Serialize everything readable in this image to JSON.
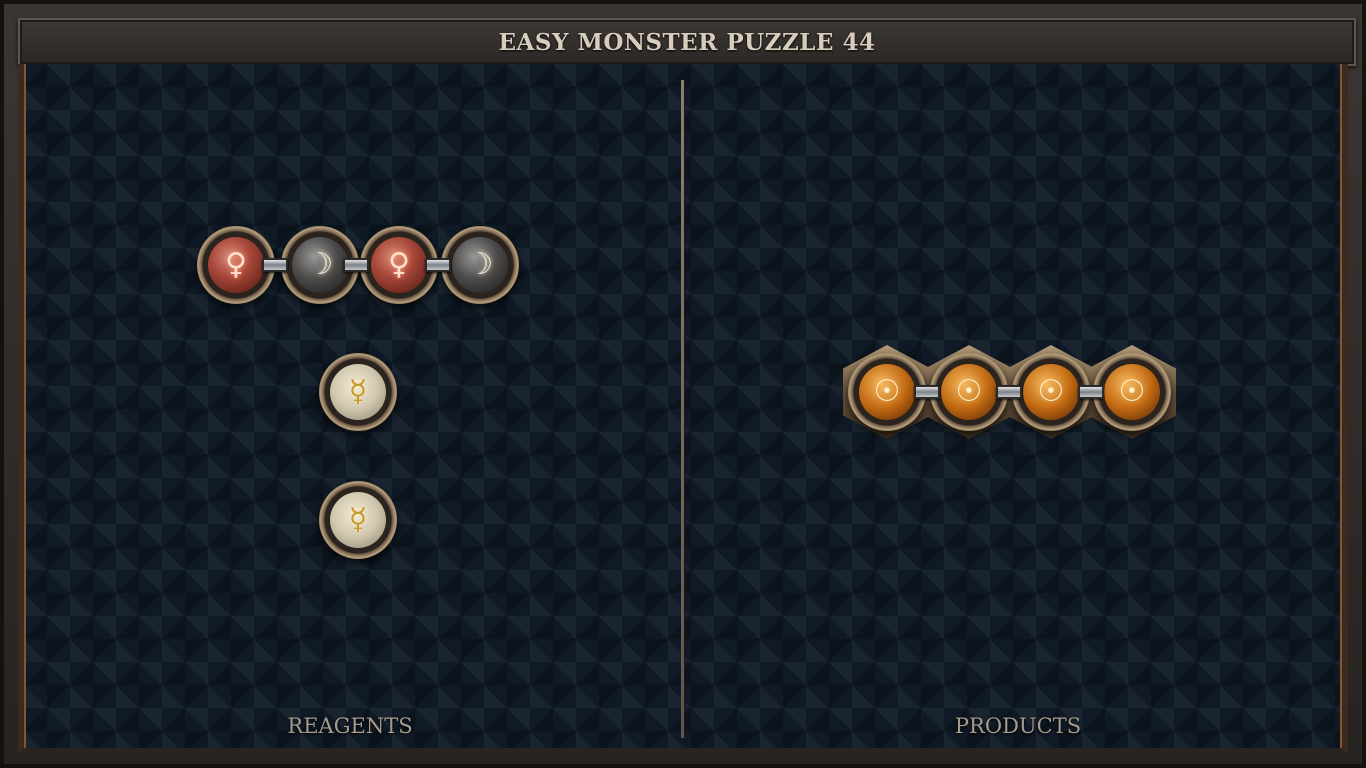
{
  "title": "EASY MONSTER PUZZLE 44",
  "sections": {
    "reagents_label": "REAGENTS",
    "products_label": "PRODUCTS"
  },
  "reagents": {
    "molecule_1": [
      {
        "element": "copper",
        "symbol": "♀"
      },
      {
        "element": "silver",
        "symbol": "☽"
      },
      {
        "element": "copper",
        "symbol": "♀"
      },
      {
        "element": "silver",
        "symbol": "☽"
      }
    ],
    "molecule_2": [
      {
        "element": "quicksilver",
        "symbol": "☿"
      }
    ],
    "molecule_3": [
      {
        "element": "quicksilver",
        "symbol": "☿"
      }
    ]
  },
  "products": {
    "molecule_1": [
      {
        "element": "gold",
        "symbol": "☉"
      },
      {
        "element": "gold",
        "symbol": "☉"
      },
      {
        "element": "gold",
        "symbol": "☉"
      },
      {
        "element": "gold",
        "symbol": "☉"
      }
    ]
  },
  "colors": {
    "copper": "#a8483a",
    "silver": "#4e4c4b",
    "quicksilver": "#cfc6ad",
    "gold": "#c26a12",
    "title_text": "#d8cdbd",
    "label_text": "#a69b8c"
  }
}
